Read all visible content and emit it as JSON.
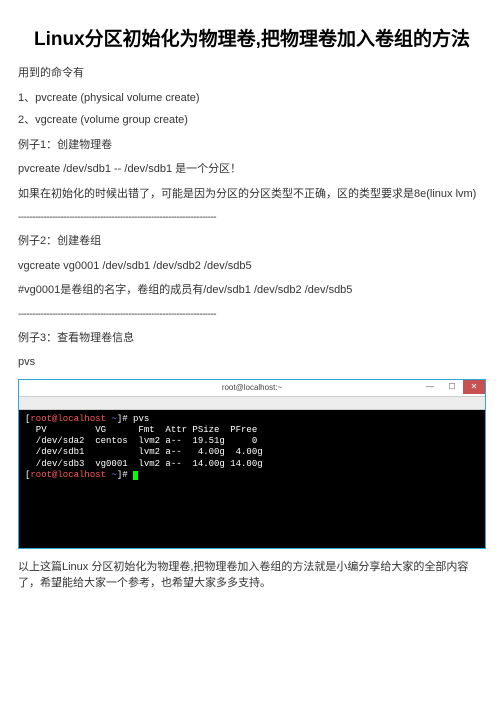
{
  "title": "Linux分区初始化为物理卷,把物理卷加入卷组的方法",
  "intro": "用到的命令有",
  "cmd1": "1、pvcreate        (physical volume create)",
  "cmd2": "2、vgcreate        (volume group create)",
  "ex1_title": "例子1：创建物理卷",
  "ex1_cmd": "pvcreate /dev/sdb1 -- /dev/sdb1 是一个分区！",
  "ex1_note": "如果在初始化的时候出错了，可能是因为分区的分区类型不正确，区的类型要求是8e(linux lvm)",
  "sep": "----------------------------------------------------------------------",
  "ex2_title": "例子2：创建卷组",
  "ex2_cmd": "vgcreate vg0001 /dev/sdb1 /dev/sdb2 /dev/sdb5",
  "ex2_note": "#vg0001是卷组的名字，卷组的成员有/dev/sdb1 /dev/sdb2 /dev/sdb5",
  "ex3_title": "例子3：查看物理卷信息",
  "ex3_cmd": "pvs",
  "terminal": {
    "window_title": "root@localhost:~",
    "btn_min": "—",
    "btn_max": "☐",
    "btn_close": "✕",
    "prompt_open": "[",
    "prompt_user": "root@localhost",
    "prompt_sep": " ",
    "prompt_tilde": "~",
    "prompt_close": "]# ",
    "cmd": "pvs",
    "header": "  PV         VG      Fmt  Attr PSize  PFree",
    "rows": [
      "  /dev/sda2  centos  lvm2 a--  19.51g     0",
      "  /dev/sdb1          lvm2 a--   4.00g  4.00g",
      "  /dev/sdb3  vg0001  lvm2 a--  14.00g 14.00g"
    ]
  },
  "conclusion": "以上这篇Linux 分区初始化为物理卷,把物理卷加入卷组的方法就是小编分享给大家的全部内容了，希望能给大家一个参考，也希望大家多多支持。"
}
